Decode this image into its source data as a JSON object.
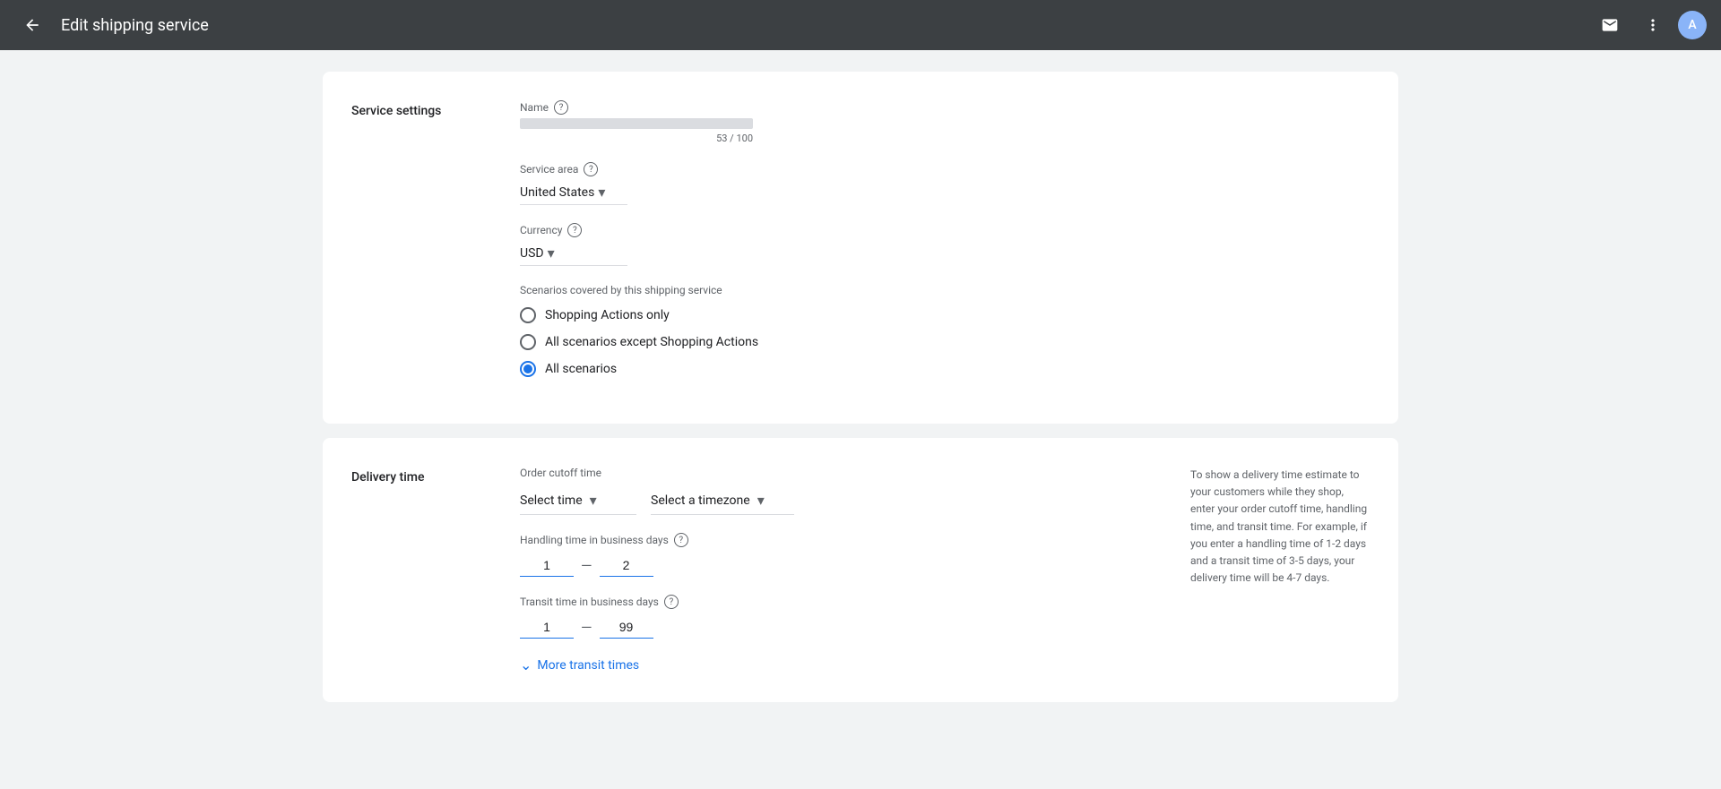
{
  "topbar": {
    "title": "Edit shipping service",
    "back_label": "←",
    "mail_icon": "✉",
    "menu_icon": "⋮",
    "avatar_label": "A",
    "colors": {
      "topbar_bg": "#3c4043",
      "avatar_bg": "#8ab4f8"
    }
  },
  "service_settings": {
    "section_title": "Service settings",
    "name_label": "Name",
    "name_char_count": "53 / 100",
    "service_area_label": "Service area",
    "service_area_value": "United States",
    "currency_label": "Currency",
    "currency_value": "USD",
    "scenarios_label": "Scenarios covered by this shipping service",
    "scenarios": [
      {
        "id": "shopping-actions-only",
        "label": "Shopping Actions only",
        "selected": false
      },
      {
        "id": "all-except-shopping",
        "label": "All scenarios except Shopping Actions",
        "selected": false
      },
      {
        "id": "all-scenarios",
        "label": "All scenarios",
        "selected": true
      }
    ]
  },
  "delivery_time": {
    "section_title": "Delivery time",
    "cutoff_label": "Order cutoff time",
    "select_time_placeholder": "Select time",
    "select_timezone_placeholder": "Select a timezone",
    "handling_time_label": "Handling time in business days",
    "handling_min": "1",
    "handling_max": "2",
    "transit_time_label": "Transit time in business days",
    "transit_min": "1",
    "transit_max": "99",
    "more_transit_label": "More transit times",
    "hint_text": "To show a delivery time estimate to your customers while they shop, enter your order cutoff time, handling time, and transit time. For example, if you enter a handling time of 1-2 days and a transit time of 3-5 days, your delivery time will be 4-7 days."
  }
}
